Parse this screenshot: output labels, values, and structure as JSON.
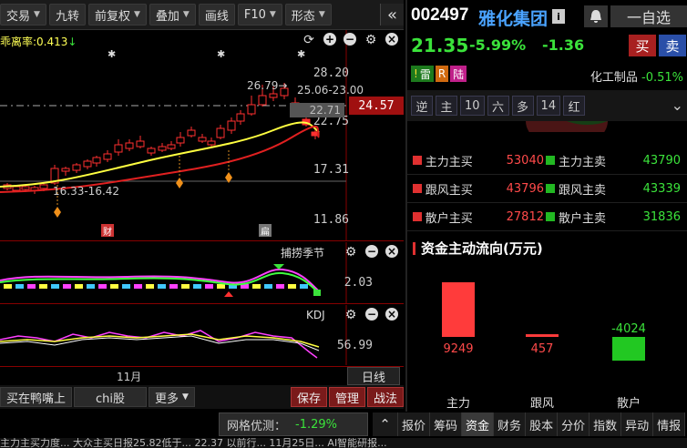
{
  "toolbar": {
    "items": [
      "交易",
      "九转",
      "前复权",
      "叠加",
      "画线",
      "F10",
      "形态"
    ],
    "carets": [
      true,
      false,
      true,
      true,
      false,
      true,
      true
    ],
    "collapse_icon": "double-chevron-left"
  },
  "main_chart": {
    "indicator_label": "乖离率:0.413",
    "indicator_arrow": "↓",
    "price_labels": [
      "28.20",
      "22.75",
      "17.31",
      "11.86"
    ],
    "current_price": "24.57",
    "grey_price": "22.71",
    "annot_high": "26.79→",
    "annot_range": "25.06-23.00",
    "annot_low": "16.33-16.42",
    "badge_cai": "财",
    "badge_grey": "扁"
  },
  "sub_chart1": {
    "title": "捕捞季节",
    "value": "2.03"
  },
  "sub_chart2": {
    "title": "KDJ",
    "value": "56.99"
  },
  "xaxis": {
    "month": "11月",
    "period": "日线"
  },
  "bottom_bar": {
    "buttons": [
      "买在鸭嘴上",
      "chi股",
      "更多"
    ],
    "more_caret": true,
    "red_buttons": [
      "保存",
      "管理",
      "战法"
    ]
  },
  "stock": {
    "code": "002497",
    "name": "雅化集团",
    "info_icon": "i",
    "watch_label": "一自选",
    "price": "21.35",
    "pct": "-5.99%",
    "change": "-1.36",
    "buy": "买",
    "sell": "卖",
    "tags": [
      "雷",
      "R",
      "陆"
    ],
    "sector_name": "化工制品",
    "sector_pct": "-0.51%"
  },
  "filters": [
    "逆",
    "主",
    "10",
    "六",
    "多",
    "14",
    "红"
  ],
  "flow_rows": [
    {
      "l_label": "主力主买",
      "l_val": "53040",
      "r_label": "主力主卖",
      "r_val": "43790"
    },
    {
      "l_label": "跟风主买",
      "l_val": "43796",
      "r_label": "跟风主卖",
      "r_val": "43339"
    },
    {
      "l_label": "散户主买",
      "l_val": "27812",
      "r_label": "散户主卖",
      "r_val": "31836"
    }
  ],
  "fund": {
    "title": "资金主动流向(万元)",
    "chart_data": {
      "type": "bar",
      "title": "资金主动流向(万元)",
      "categories": [
        "主力",
        "跟风",
        "散户"
      ],
      "values": [
        9249,
        457,
        -4024
      ],
      "colors": [
        "#ff3b3b",
        "#ff3b3b",
        "#22c822"
      ]
    }
  },
  "grid_opt": {
    "label": "网格优测：",
    "pct": "-1.29%"
  },
  "right_tabs": [
    "报价",
    "筹码",
    "资金",
    "财务",
    "股本",
    "分价",
    "指数",
    "异动",
    "情报"
  ],
  "right_tabs_active": "资金",
  "ticker": "主力主买力度... 大众主买日报25.82低于... 22.37 以前行... 11月25日... AI智能研报..."
}
